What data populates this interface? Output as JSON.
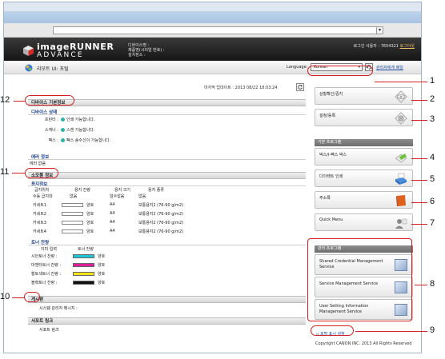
{
  "browser": {
    "address_value": ""
  },
  "header": {
    "brand_line1": "imageRUNNER",
    "brand_line2": "ADVANCE",
    "device_name_label": "디바이스명 :",
    "product_label": "제품명(시리얼 번호) :",
    "location_label": "설치장소 :",
    "user_label": "로그인 사용자 : 7654321",
    "logout": "로그아웃"
  },
  "rui_bar": {
    "title": "리모트 UI: 포털",
    "language_label": "Language:",
    "language_value": "Korean",
    "admin_link": "관리자에게 메일"
  },
  "main": {
    "last_update": "마지막 업데이트 : 2013 08/22 18:03:24",
    "device_basic": {
      "title": "디바이스 기본정보",
      "status_title": "디바이스 상태",
      "rows": [
        {
          "label": "프린터 :",
          "value": "인쇄 가능합니다."
        },
        {
          "label": "스캐너 :",
          "value": "스캔 가능합니다."
        },
        {
          "label": "팩스 :",
          "value": "팩스 송수신이 가능합니다."
        }
      ],
      "error_title": "에러 정보",
      "error_value": "에러 없음"
    },
    "consumables": {
      "title": "소모품 정보",
      "paper_title": "용지정보",
      "paper_headers": [
        "급지위치",
        "용지 잔량",
        "용지 크기",
        "용지 종류"
      ],
      "paper_rows": [
        {
          "source": "수동 급지대",
          "level": "없음",
          "size": "알수없음",
          "type": "없음"
        },
        {
          "source": "카세트1",
          "level": "양호",
          "size": "A4",
          "type": "보통용지2 (76-90 g/m2)"
        },
        {
          "source": "카세트2",
          "level": "양호",
          "size": "A4",
          "type": "보통용지2 (76-90 g/m2)"
        },
        {
          "source": "카세트3",
          "level": "양호",
          "size": "A4",
          "type": "보통용지2 (76-90 g/m2)"
        },
        {
          "source": "카세트4",
          "level": "양호",
          "size": "A4",
          "type": "보통용지2 (76-90 g/m2)"
        }
      ],
      "toner_title": "토너 잔량",
      "toner_headers": [
        "이미 입력",
        "토너 잔량"
      ],
      "toner_rows": [
        {
          "name": "시안토너 잔량 :",
          "color": "#21c5d8",
          "status": "양호"
        },
        {
          "name": "마젠타토너 잔량 :",
          "color": "#e0209a",
          "status": "양호"
        },
        {
          "name": "황토색토너 잔량 :",
          "color": "#f3e51a",
          "status": "양호"
        },
        {
          "name": "블랙토너 잔량 :",
          "color": "#111111",
          "status": "양호"
        }
      ]
    },
    "notice": {
      "title": "게시판",
      "row": "시스템 관리자 메시지 :"
    },
    "support": {
      "title": "서포트 링크",
      "row": "서포트 링크"
    }
  },
  "right_panel": {
    "status_monitor": "상황확인/중지",
    "settings": "설정/등록",
    "basic_tools_title": "기본 프로그램",
    "fax_box": "박스/I-팩스 박스",
    "direct_print": "다이렉트 인쇄",
    "address_book": "주소록",
    "quick_menu": "Quick Menu",
    "mgmt_title": "관리 프로그램",
    "mgmt_items": [
      "Shared Credential Management Service",
      "Service Management Service",
      "User Setting Information Management Service"
    ],
    "support_link": "포털 표시 설정",
    "copyright": "Copyright CANON INC. 2013 All Rights Reserved"
  },
  "callouts": [
    "1",
    "2",
    "3",
    "4",
    "5",
    "6",
    "7",
    "8",
    "9",
    "10",
    "11",
    "12"
  ]
}
